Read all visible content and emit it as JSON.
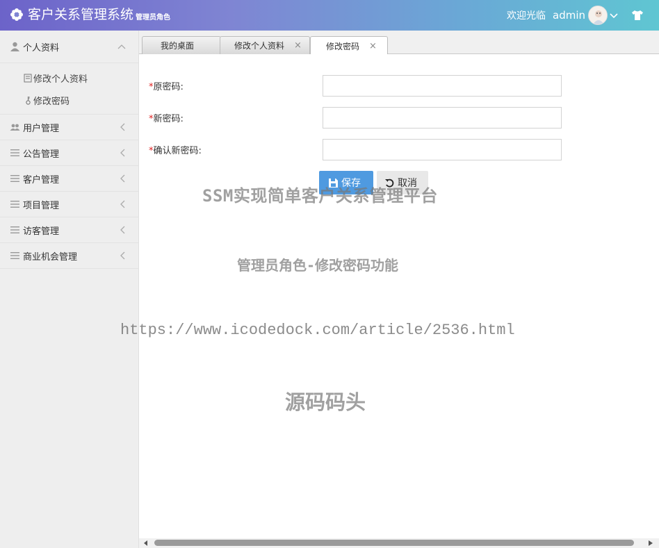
{
  "header": {
    "title": "客户关系管理系统",
    "role_label": "管理员角色",
    "welcome": "欢迎光临",
    "username": "admin",
    "logo_icon": "gear-flower-icon",
    "theme_icon": "shirt-icon"
  },
  "sidebar": {
    "open_section": {
      "label": "个人资料",
      "icon": "user-icon",
      "items": [
        {
          "label": "修改个人资料",
          "icon": "edit-icon"
        },
        {
          "label": "修改密码",
          "icon": "key-icon"
        }
      ]
    },
    "sections": [
      {
        "label": "用户管理",
        "icon": "users-icon"
      },
      {
        "label": "公告管理",
        "icon": "list-icon"
      },
      {
        "label": "客户管理",
        "icon": "list-icon"
      },
      {
        "label": "项目管理",
        "icon": "list-icon"
      },
      {
        "label": "访客管理",
        "icon": "list-icon"
      },
      {
        "label": "商业机会管理",
        "icon": "list-icon"
      }
    ]
  },
  "tabs": [
    {
      "label": "我的桌面",
      "closable": false,
      "active": false
    },
    {
      "label": "修改个人资料",
      "closable": true,
      "close": "×",
      "active": false
    },
    {
      "label": "修改密码",
      "closable": true,
      "close": "×",
      "active": true
    }
  ],
  "form": {
    "required_mark": "*",
    "fields": [
      {
        "label": "原密码:",
        "value": ""
      },
      {
        "label": "新密码:",
        "value": ""
      },
      {
        "label": "确认新密码:",
        "value": ""
      }
    ],
    "save_label": "保存",
    "cancel_label": "取消"
  },
  "watermark": {
    "line1": "SSM实现简单客户关系管理平台",
    "line2": "管理员角色-修改密码功能",
    "line3": "https://www.icodedock.com/article/2536.html",
    "line4": "源码码头"
  },
  "colors": {
    "header_start": "#6c63c9",
    "header_end": "#5fc6d2",
    "save_button": "#4f9ae0",
    "required": "#e02020"
  }
}
